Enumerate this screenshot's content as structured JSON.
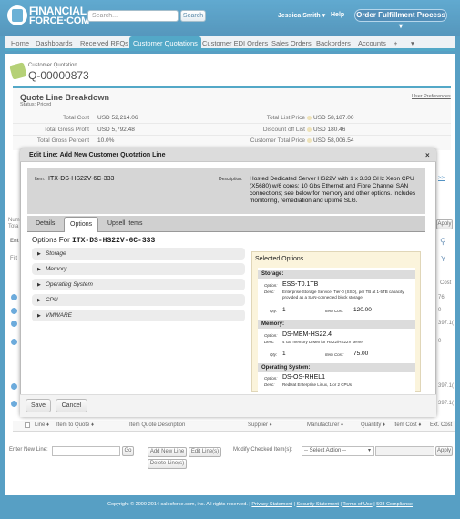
{
  "header": {
    "logo_line1": "FINANCIAL",
    "logo_line2": "FORCE·COM",
    "search_placeholder": "Search...",
    "search_button": "Search",
    "user_menu": "Jessica Smith ▾",
    "help": "Help",
    "app_menu": "Order Fulfillment Process ▾"
  },
  "nav": {
    "tabs": [
      "Home",
      "Dashboards",
      "Received RFQs",
      "Customer Quotations",
      "Customer EDI Orders",
      "Sales Orders",
      "Backorders",
      "Accounts",
      "+",
      "▾"
    ],
    "active": "Customer Quotations"
  },
  "record": {
    "type": "Customer Quotation",
    "name": "Q-00000873"
  },
  "section": {
    "title": "Quote Line Breakdown",
    "status": "Status: Priced",
    "user_preferences": "User Preferences",
    "fields_left": [
      {
        "label": "Total Cost",
        "value": "USD 52,214.06"
      },
      {
        "label": "Total Gross Profit",
        "value": "USD 5,792.48"
      },
      {
        "label": "Total Gross Percent",
        "value": "10.0%"
      }
    ],
    "fields_right": [
      {
        "label": "Total List Price",
        "value": "USD 58,187.00"
      },
      {
        "label": "Discount off List",
        "value": "USD 180.46"
      },
      {
        "label": "Customer Total Price",
        "value": "USD 58,006.54"
      }
    ]
  },
  "background": {
    "num_label": "Num",
    "tota_label": "Tota",
    "ent_label": "Ent",
    "filt_label": "Filt",
    "apply_top": "Apply",
    "chevrons": ">>",
    "cost_col": "Cost",
    "side_values": [
      "76",
      "0",
      "397.1(",
      "0",
      "397.1(",
      "397.1("
    ]
  },
  "table": {
    "headers": [
      "Line ♦",
      "Item to Quote ♦",
      "Item Quote Description",
      "Supplier ♦",
      "Manufacturer ♦",
      "Quantity ♦",
      "Item Cost ♦",
      "Ext. Cost"
    ]
  },
  "bottom": {
    "enter_new_line": "Enter New Line:",
    "go": "Go",
    "add_new_line": "Add New Line",
    "edit_lines": "Edit Line(s)",
    "delete_lines": "Delete Line(s)",
    "modify_label": "Modify Checked Item(s):",
    "select_action": "-- Select Action --",
    "apply": "Apply"
  },
  "footer": {
    "copyright": "Copyright © 2000-2014 salesforce.com, inc. All rights reserved. |",
    "links": [
      "Privacy Statement",
      "Security Statement",
      "Terms of Use",
      "508 Compliance"
    ]
  },
  "modal": {
    "title": "Edit Line: Add New Customer Quotation Line",
    "close": "×",
    "item_label": "Item:",
    "item_value": "ITX-DS-HS22V-6C-333",
    "description_label": "Description:",
    "description_value": "Hosted Dedicated Server HS22V with 1 x 3.33 GHz Xeon CPU (X5680) w/6 cores; 10 Gbs Ethernet and Fibre Channel SAN connections; see below for memory and other options. Includes monitoring, remediation and uptime SLG.",
    "tabs": [
      "Details",
      "Options",
      "Upsell Items"
    ],
    "active_tab": "Options",
    "options_for_label": "Options For",
    "options_for_item": "ITX-DS-HS22V-6C-333",
    "categories": [
      "Storage",
      "Memory",
      "Operating System",
      "CPU",
      "VMWARE"
    ],
    "selected_title": "Selected Options",
    "selected": [
      {
        "group": "Storage:",
        "option": "ESS-T0.1TB",
        "desc": "Enterprise Storage Service, Tier-0 (SSD), per TB at 1-5TB capacity, provided as a SAN-connected block storage",
        "qty": "1",
        "cost": "120.00"
      },
      {
        "group": "Memory:",
        "option": "DS-MEM-HS22.4",
        "desc": "4 GB memory DIMM for HS22/HS22V server",
        "qty": "1",
        "cost": "75.00"
      },
      {
        "group": "Operating System:",
        "option": "DS-OS-RHEL1",
        "desc": "RedHat Enterprise Linux, 1 or 2 CPUs",
        "qty": "",
        "cost": ""
      }
    ],
    "option_key": "Option:",
    "desc_key": "Desc:",
    "qty_key": "Qty:",
    "cost_key": "Item Cost:",
    "save": "Save",
    "cancel": "Cancel"
  },
  "colors": {
    "brand": "#1f7fb0",
    "tab_active": "#1a8bb5",
    "selected_bg": "#fbf4dc"
  }
}
